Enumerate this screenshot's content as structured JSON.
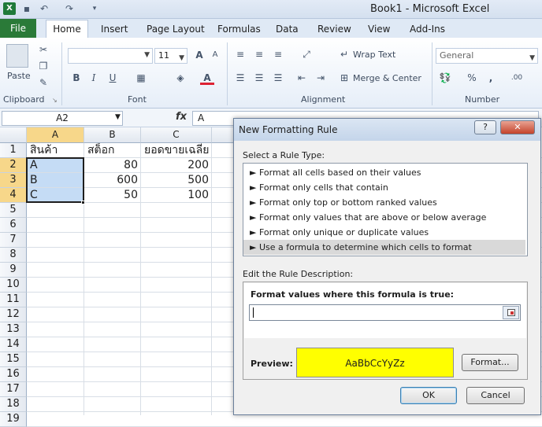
{
  "window": {
    "title": "Book1 - Microsoft Excel"
  },
  "qat": {
    "save": "save-icon",
    "undo": "undo-icon",
    "redo": "redo-icon"
  },
  "tabs": [
    "File",
    "Home",
    "Insert",
    "Page Layout",
    "Formulas",
    "Data",
    "Review",
    "View",
    "Add-Ins"
  ],
  "ribbon": {
    "clipboard": {
      "paste_label": "Paste",
      "group_label": "Clipboard"
    },
    "font": {
      "font_size": "11",
      "group_label": "Font",
      "bold": "B",
      "italic": "I",
      "underline": "U",
      "grow": "A",
      "shrink": "A",
      "color": "A"
    },
    "alignment": {
      "wrap_text": "Wrap Text",
      "merge_center": "Merge & Center",
      "group_label": "Alignment"
    },
    "number": {
      "format": "General",
      "percent": "%",
      "comma": ",",
      "inc_dec": ".00",
      "group_label": "Number"
    }
  },
  "formula_bar": {
    "name_box": "A2",
    "fx": "fx",
    "content": "A"
  },
  "sheet": {
    "columns": [
      "A",
      "B",
      "C"
    ],
    "rows": [
      "1",
      "2",
      "3",
      "4",
      "5",
      "6",
      "7",
      "8",
      "9",
      "10",
      "11",
      "12",
      "13",
      "14",
      "15",
      "16",
      "17",
      "18",
      "19"
    ],
    "cells": [
      {
        "a": "สินค้า",
        "b": "สต็อก",
        "c": "ยอดขายเฉลี่ย"
      },
      {
        "a": "A",
        "b": "80",
        "c": "200"
      },
      {
        "a": "B",
        "b": "600",
        "c": "500"
      },
      {
        "a": "C",
        "b": "50",
        "c": "100"
      }
    ]
  },
  "dialog": {
    "title": "New Formatting Rule",
    "help": "?",
    "select_label": "Select a Rule Type:",
    "rules": [
      "► Format all cells based on their values",
      "► Format only cells that contain",
      "► Format only top or bottom ranked values",
      "► Format only values that are above or below average",
      "► Format only unique or duplicate values",
      "► Use a formula to determine which cells to format"
    ],
    "edit_label": "Edit the Rule Description:",
    "formula_label": "Format values where this formula is true:",
    "formula_value": "",
    "preview_label": "Preview:",
    "preview_text": "AaBbCcYyZz",
    "preview_color": "#ffff00",
    "format_button": "Format...",
    "ok": "OK",
    "cancel": "Cancel"
  }
}
